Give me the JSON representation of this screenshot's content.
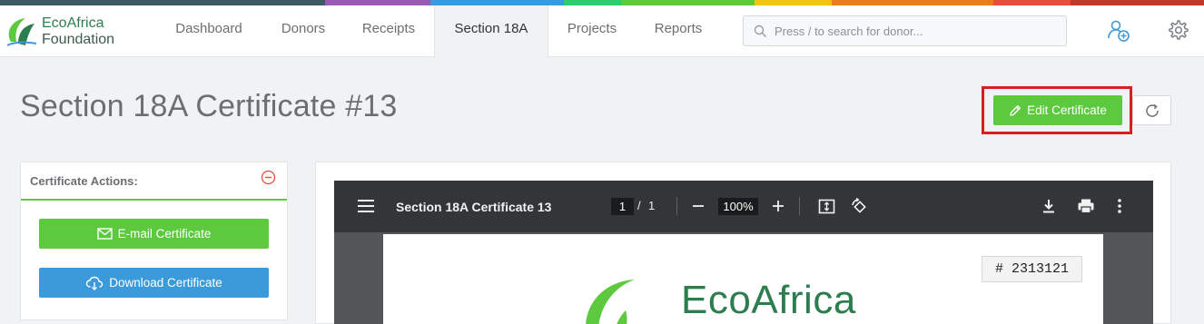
{
  "brand": {
    "line1": "EcoAfrica",
    "line2": "Foundation"
  },
  "nav": {
    "items": [
      {
        "label": "Dashboard"
      },
      {
        "label": "Donors"
      },
      {
        "label": "Receipts"
      },
      {
        "label": "Section 18A",
        "active": true
      },
      {
        "label": "Projects"
      },
      {
        "label": "Reports"
      }
    ]
  },
  "search": {
    "placeholder": "Press / to search for donor..."
  },
  "header_icons": [
    "add-user-icon",
    "gear-icon"
  ],
  "page": {
    "title": "Section 18A Certificate #13"
  },
  "toolbar": {
    "edit_label": "Edit Certificate"
  },
  "actions": {
    "title": "Certificate Actions:",
    "email_label": "E-mail Certificate",
    "download_label": "Download Certificate"
  },
  "pdf": {
    "title": "Section 18A Certificate 13",
    "page_current": "1",
    "page_sep": "/",
    "page_total": "1",
    "zoom": "100%",
    "cert_number": "# 2313121",
    "logo_text": "EcoAfrica"
  },
  "colors": {
    "accent_green": "#5dc93e",
    "accent_blue": "#3b9ad9",
    "highlight_red": "#d9201f",
    "stripe": [
      "#3d5a63",
      "#9b59b6",
      "#3b9ad9",
      "#2ecc71",
      "#5dc93e",
      "#f1c40f",
      "#e67e22",
      "#e74c3c",
      "#c0392b"
    ]
  }
}
